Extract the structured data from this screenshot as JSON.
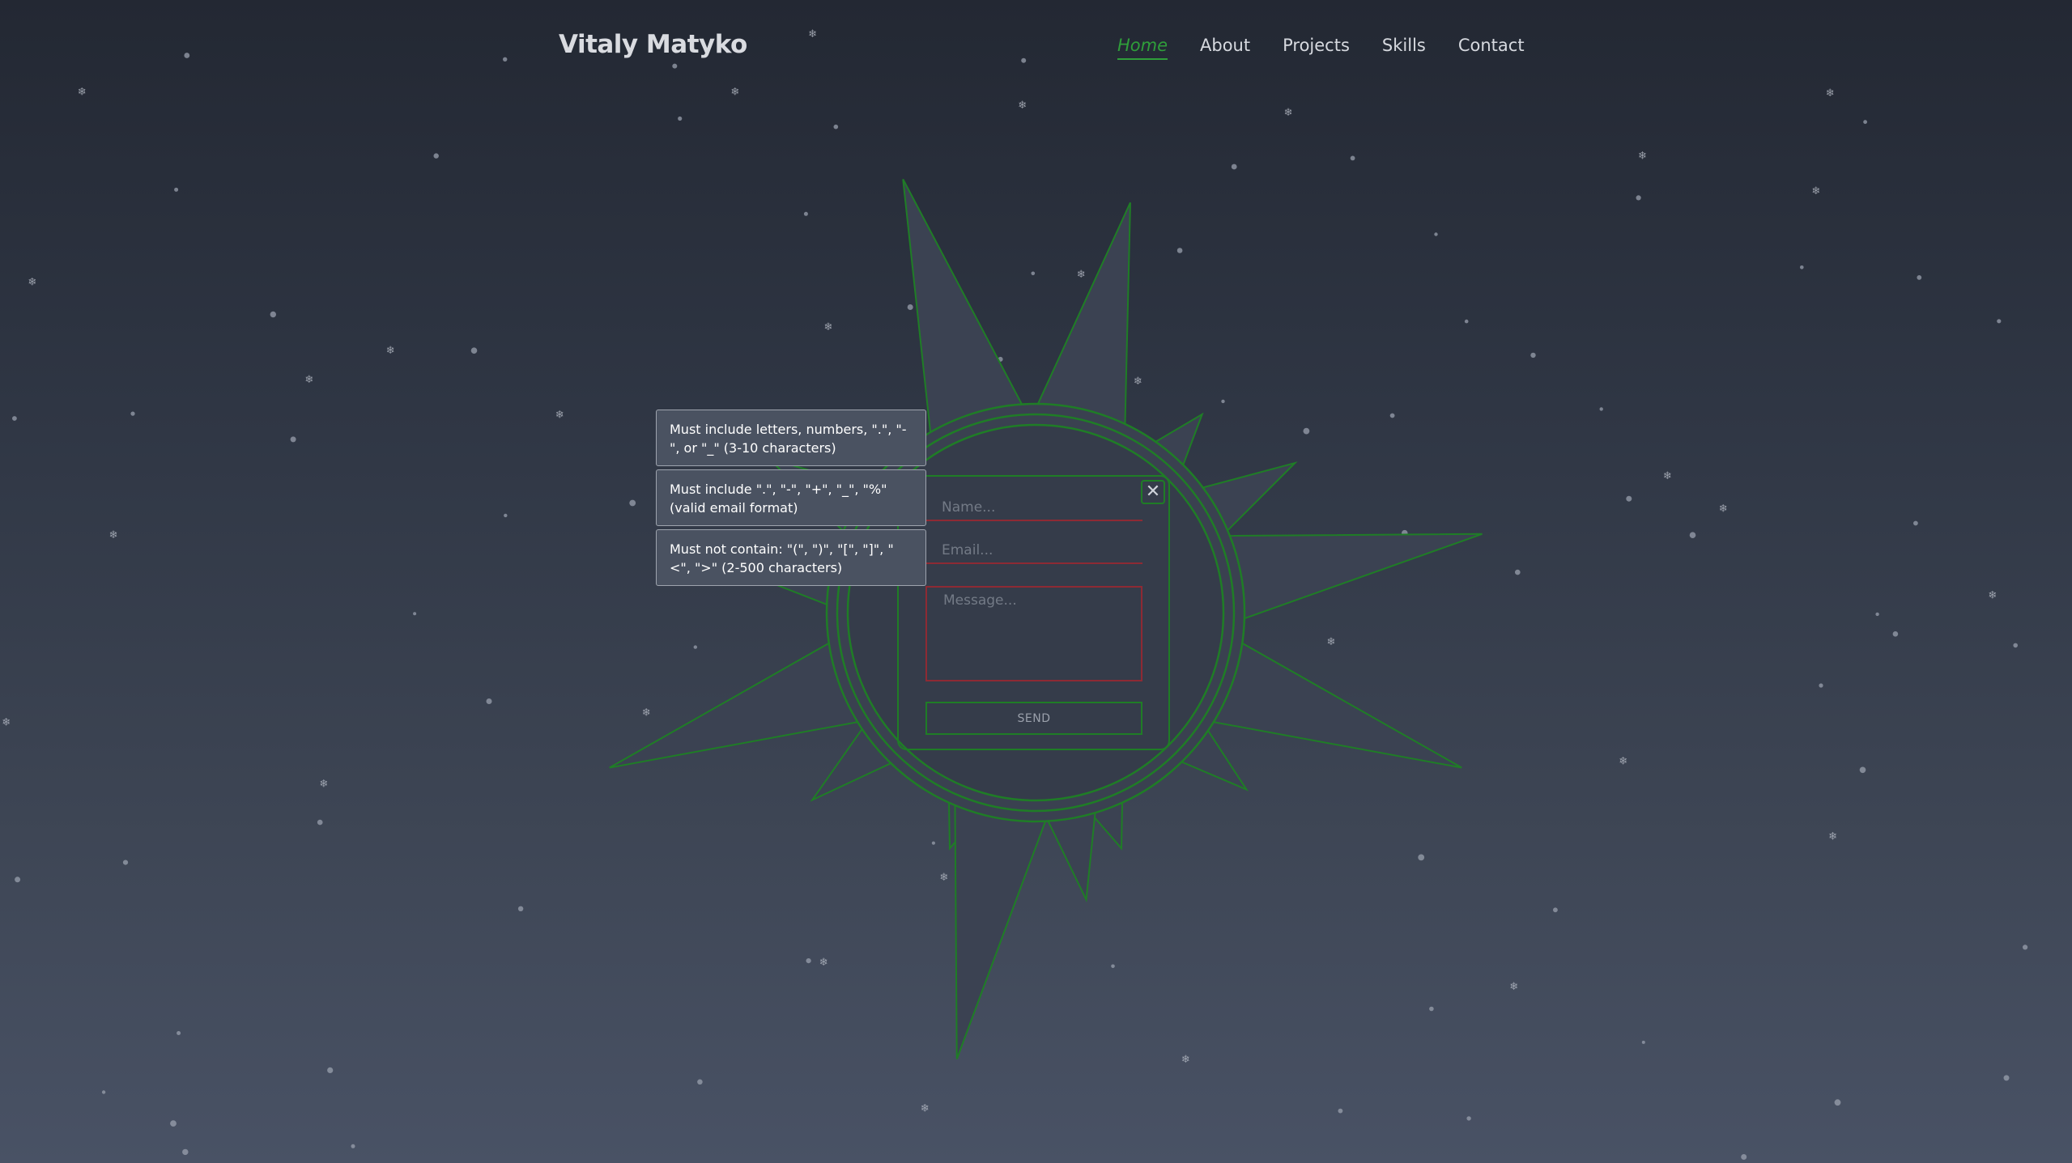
{
  "header": {
    "logo": "Vitaly Matyko",
    "nav": [
      {
        "label": "Home",
        "active": true
      },
      {
        "label": "About",
        "active": false
      },
      {
        "label": "Projects",
        "active": false
      },
      {
        "label": "Skills",
        "active": false
      },
      {
        "label": "Contact",
        "active": false
      }
    ]
  },
  "form": {
    "name_placeholder": "Name...",
    "email_placeholder": "Email...",
    "message_placeholder": "Message...",
    "send_label": "SEND",
    "close_label": "✕"
  },
  "tooltips": {
    "name": "Must include letters, numbers, \".\", \"-\", or \"_\" (3-10 characters)",
    "email": "Must include \".\", \"-\", \"+\", \"_\", \"%\" (valid email format)",
    "message": "Must not contain: \"(\", \")\", \"[\", \"]\", \"<\", \">\" (2-500 characters)"
  },
  "colors": {
    "accent_green": "#1f7d26",
    "error_red": "#8e2a34",
    "background_top": "#232833",
    "background_bottom": "#495265"
  }
}
